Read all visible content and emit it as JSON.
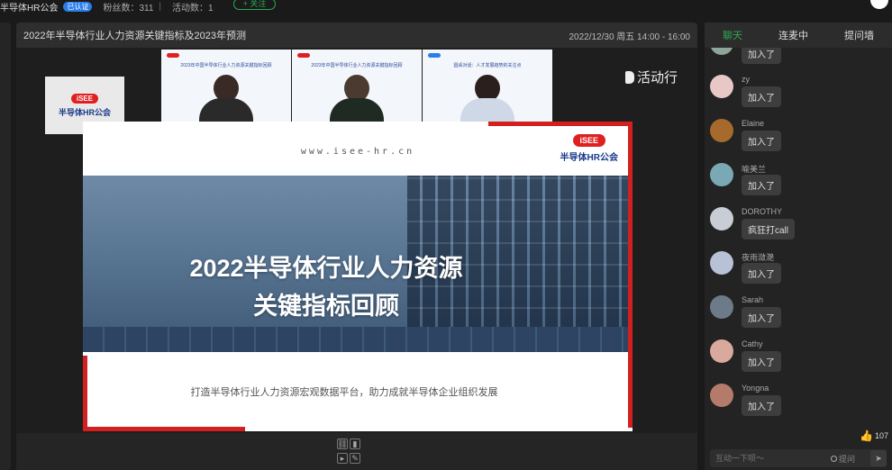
{
  "topbar": {
    "org_name": "半导体HR公会",
    "verified": "已认证",
    "fans_label": "粉丝数：311",
    "activities_label": "活动数：1",
    "follow_label": "+ 关注"
  },
  "stream": {
    "title": "2022年半导体行业人力资源关键指标及2023年预测",
    "time": "2022/12/30 周五 14:00 - 16:00",
    "watermark": "活动行",
    "logo_badge": "iSEE",
    "logo_org": "半导体HR公会"
  },
  "tiles": [
    {
      "title": "2023年中国半导体行业人力资源关键指标回顾"
    },
    {
      "title": "2023年中国半导体行业人力资源关键指标回顾"
    },
    {
      "title": "圆桌对话：人才发展趋势的关注点"
    }
  ],
  "slide": {
    "url": "www.isee-hr.cn",
    "logo_badge": "iSEE",
    "logo_org": "半导体HR公会",
    "headline_1": "2022半导体行业人力资源",
    "headline_2": "关键指标回顾",
    "tagline": "打造半导体行业人力资源宏观数据平台，助力成就半导体企业组织发展"
  },
  "side": {
    "tabs": [
      "聊天",
      "连麦中",
      "提问墙"
    ],
    "messages": [
      {
        "nick": "",
        "text": "加入了"
      },
      {
        "nick": "zy",
        "text": "加入了"
      },
      {
        "nick": "Elaine",
        "text": "加入了"
      },
      {
        "nick": "喻美兰",
        "text": "加入了"
      },
      {
        "nick": "DOROTHY",
        "text": "疯狂打call"
      },
      {
        "nick": "夜雨潋滟",
        "text": "加入了"
      },
      {
        "nick": "Sarah",
        "text": "加入了"
      },
      {
        "nick": "Cathy",
        "text": "加入了"
      },
      {
        "nick": "Yongna",
        "text": "加入了"
      }
    ],
    "likes": "107",
    "input_placeholder": "互动一下呗～",
    "ask_label": "提问"
  },
  "colors": {
    "accent_green": "#2fa84f",
    "brand_red": "#d21f1f",
    "brand_blue": "#1b3a8a"
  }
}
